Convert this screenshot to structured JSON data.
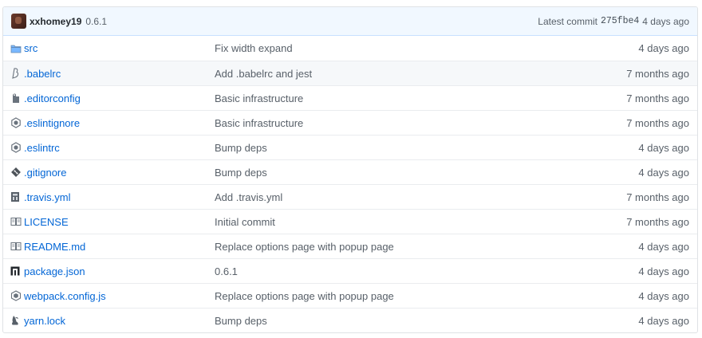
{
  "commit": {
    "author": "xxhomey19",
    "version": "0.6.1",
    "latest_label": "Latest commit",
    "sha": "275fbe4",
    "age": "4 days ago"
  },
  "files": [
    {
      "name": "src",
      "message": "Fix width expand",
      "age": "4 days ago",
      "icon": "folder-icon"
    },
    {
      "name": ".babelrc",
      "message": "Add .babelrc and jest",
      "age": "7 months ago",
      "icon": "babel-icon"
    },
    {
      "name": ".editorconfig",
      "message": "Basic infrastructure",
      "age": "7 months ago",
      "icon": "editorconfig-icon"
    },
    {
      "name": ".eslintignore",
      "message": "Basic infrastructure",
      "age": "7 months ago",
      "icon": "eslint-icon"
    },
    {
      "name": ".eslintrc",
      "message": "Bump deps",
      "age": "4 days ago",
      "icon": "eslint-icon"
    },
    {
      "name": ".gitignore",
      "message": "Bump deps",
      "age": "4 days ago",
      "icon": "git-icon"
    },
    {
      "name": ".travis.yml",
      "message": "Add .travis.yml",
      "age": "7 months ago",
      "icon": "travis-icon"
    },
    {
      "name": "LICENSE",
      "message": "Initial commit",
      "age": "7 months ago",
      "icon": "book-icon"
    },
    {
      "name": "README.md",
      "message": "Replace options page with popup page",
      "age": "4 days ago",
      "icon": "book-icon"
    },
    {
      "name": "package.json",
      "message": "0.6.1",
      "age": "4 days ago",
      "icon": "npm-icon"
    },
    {
      "name": "webpack.config.js",
      "message": "Replace options page with popup page",
      "age": "4 days ago",
      "icon": "webpack-icon"
    },
    {
      "name": "yarn.lock",
      "message": "Bump deps",
      "age": "4 days ago",
      "icon": "yarn-icon"
    }
  ]
}
